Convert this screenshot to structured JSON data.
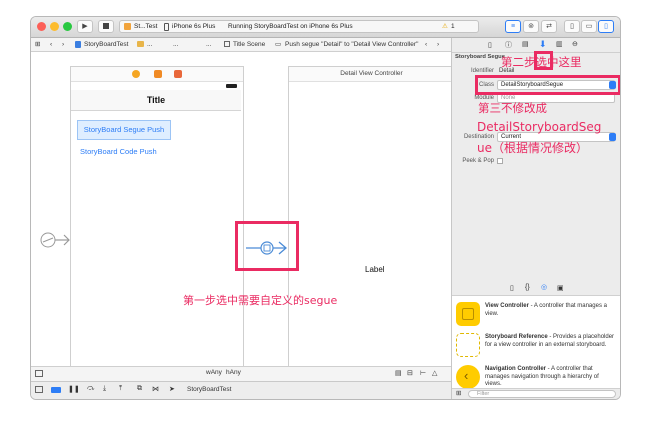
{
  "toolbar": {
    "scheme_target": "St...Test",
    "scheme_device": "iPhone 6s Plus",
    "status": "Running StoryBoardTest on iPhone 6s Plus",
    "warning_count": "1"
  },
  "jumpbar": {
    "project": "StoryBoardTest",
    "folder": "...",
    "file": "...",
    "file2": "...",
    "scene": "Title Scene",
    "segue": "Push segue \"Detail\" to \"Detail View Controller\""
  },
  "canvas": {
    "title_vc_title": "Title",
    "segue_push_label": "StoryBoard Segue Push",
    "code_push_label": "StoryBoard Code Push",
    "detail_vc_header": "Detail View Controller",
    "detail_label": "Label"
  },
  "size_class": {
    "w": "wAny",
    "h": "hAny"
  },
  "inspector": {
    "section": "Storyboard Segue",
    "identifier_label": "Identifier",
    "identifier_value": "Detail",
    "class_label": "Class",
    "class_value": "DetailStoryboardSegue",
    "module_label": "Module",
    "module_value": "None",
    "destination_label": "Destination",
    "destination_value": "Current",
    "peek_label": "Peek & Pop"
  },
  "library": {
    "items": [
      {
        "title": "View Controller",
        "desc": " - A controller that manages a view."
      },
      {
        "title": "Storyboard Reference",
        "desc": " - Provides a placeholder for a view controller in an external storyboard."
      },
      {
        "title": "Navigation Controller",
        "desc": " - A controller that manages navigation through a hierarchy of views."
      }
    ],
    "filter_placeholder": "Filter"
  },
  "debug": {
    "target": "StoryBoardTest"
  },
  "annotations": {
    "step1": "第一步选中需要自定义的segue",
    "step2": "第二步选中这里",
    "step3_line1": "第三不修改成",
    "step3_line2": "DetailStoryboardSeg",
    "step3_line3": "ue（根据情况修改）"
  },
  "colors": {
    "accent": "#2d7df6",
    "annotation": "#ea2b62",
    "library_icon": "#ffcc00"
  }
}
